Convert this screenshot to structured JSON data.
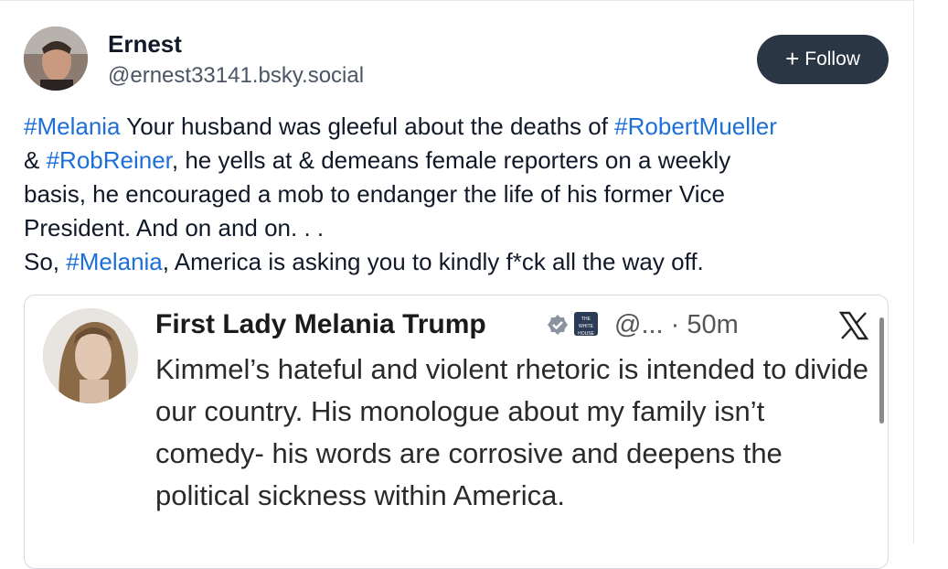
{
  "post": {
    "author_name": "Ernest",
    "author_handle": "@ernest33141.bsky.social",
    "follow_label": "Follow",
    "text_segments": [
      {
        "t": "#Melania",
        "tag": true
      },
      {
        "t": " Your husband was gleeful about the deaths of ",
        "tag": false
      },
      {
        "t": "#RobertMueller",
        "tag": true
      },
      {
        "t": "\n& ",
        "tag": false
      },
      {
        "t": "#RobReiner",
        "tag": true
      },
      {
        "t": ", he yells at & demeans female reporters on a weekly\nbasis, he encouraged a mob to endanger the life of his former Vice\nPresident. And on and on. . .\nSo, ",
        "tag": false
      },
      {
        "t": "#Melania",
        "tag": true
      },
      {
        "t": ", America is asking you to kindly f*ck all the way off.",
        "tag": false
      }
    ]
  },
  "quote": {
    "name": "First Lady Melania Trump",
    "handle_time": "@... · 50m",
    "text": "Kimmel’s hateful and violent rhetoric is intended to divide our country.  His monologue about my family isn’t comedy- his words are corrosive and deepens the political sickness within America.",
    "badge_org": "THE WHITE HOUSE",
    "icons": [
      "verified-badge-icon",
      "white-house-icon",
      "x-logo-icon"
    ]
  },
  "colors": {
    "hashtag": "#1d6fd8",
    "follow_bg": "#2b3645",
    "text": "#111827",
    "handle": "#4b5563"
  }
}
